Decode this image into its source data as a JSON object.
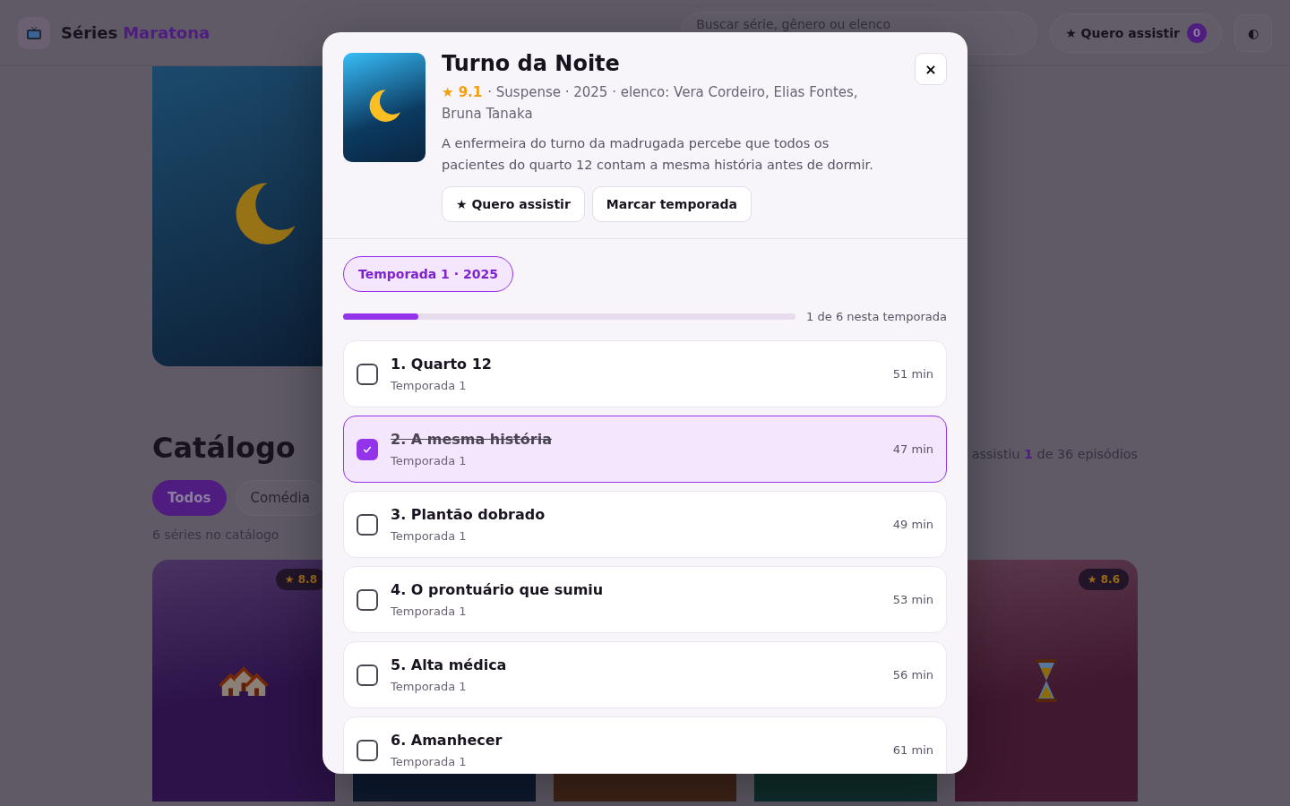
{
  "header": {
    "brand": "Séries",
    "brand_highlight": "Maratona",
    "search": {
      "placeholder": "Buscar série, gênero ou elenco"
    },
    "watchlist_button": {
      "label": "★ Quero assistir",
      "count": "0"
    },
    "theme_toggle": "◐"
  },
  "catalog": {
    "title": "Catálogo",
    "filters": [
      {
        "label": "Todos",
        "selected": true
      },
      {
        "label": "Comédia",
        "selected": false
      }
    ],
    "count": "6 séries no catálogo",
    "watched": "assistiu **1** de 36 episódios",
    "cards": [
      {
        "kind": "houses",
        "color": "#2c1248",
        "rating": "★ 8.8"
      },
      {
        "kind": "plain",
        "color": "#0d1a30"
      },
      {
        "kind": "plain",
        "color": "#3f2418"
      },
      {
        "kind": "plain",
        "color": "#0f2e2c"
      },
      {
        "kind": "hourglass",
        "color": "#40182f",
        "rating": "★ 8.6"
      }
    ]
  },
  "modal": {
    "title": "Turno da Noite",
    "rating": "★ 9.1",
    "meta": "· Suspense · 2025 · elenco: Vera Cordeiro, Elias Fontes, Bruna Tanaka",
    "description": "A enfermeira do turno da madrugada percebe que todos os pacientes do quarto 12 contam a mesma história antes de dormir.",
    "actions": [
      "★ Quero assistir",
      "Marcar temporada"
    ],
    "close": "×",
    "seasons": [
      {
        "label": "Temporada 1 · 2025",
        "selected": true
      }
    ],
    "progress": {
      "level": 0.167,
      "reading": "1 de 6 nesta temporada"
    },
    "episodes": [
      {
        "title": "1. Quarto 12",
        "subtitle": "Temporada 1",
        "duration": "51 min",
        "checked": false
      },
      {
        "title": "2. A mesma história",
        "subtitle": "Temporada 1",
        "duration": "47 min",
        "checked": true
      },
      {
        "title": "3. Plantão dobrado",
        "subtitle": "Temporada 1",
        "duration": "49 min",
        "checked": false
      },
      {
        "title": "4. O prontuário que sumiu",
        "subtitle": "Temporada 1",
        "duration": "53 min",
        "checked": false
      },
      {
        "title": "5. Alta médica",
        "subtitle": "Temporada 1",
        "duration": "56 min",
        "checked": false
      },
      {
        "title": "6. Amanhecer",
        "subtitle": "Temporada 1",
        "duration": "61 min",
        "checked": false
      }
    ]
  }
}
